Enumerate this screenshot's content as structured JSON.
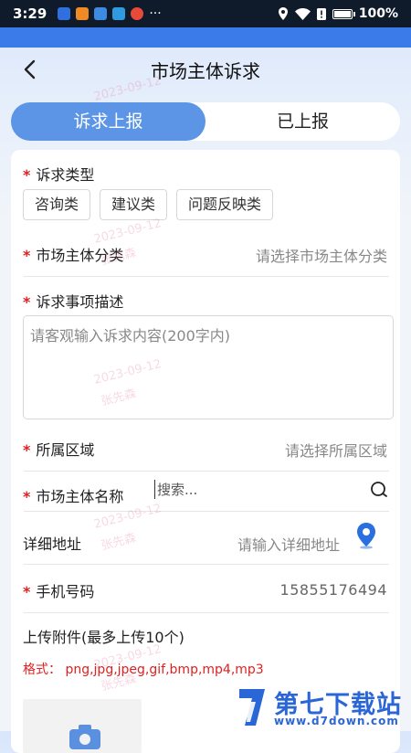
{
  "status_bar": {
    "time": "3:29",
    "more": "···",
    "battery_text": "100%",
    "battery_level": 1.0
  },
  "header": {
    "back_icon": "chevron-left-icon",
    "title": "市场主体诉求"
  },
  "tabs": [
    {
      "label": "诉求上报",
      "active": true
    },
    {
      "label": "已上报",
      "active": false
    }
  ],
  "form": {
    "required_mark": "*",
    "appeal_type": {
      "label": "诉求类型",
      "options": [
        "咨询类",
        "建议类",
        "问题反映类"
      ]
    },
    "entity_category": {
      "label": "市场主体分类",
      "placeholder": "请选择市场主体分类"
    },
    "description": {
      "label": "诉求事项描述",
      "placeholder": "请客观输入诉求内容(200字内)"
    },
    "region": {
      "label": "所属区域",
      "placeholder": "请选择所属区域"
    },
    "entity_name": {
      "label": "市场主体名称",
      "placeholder": "搜索...",
      "icon": "search-icon"
    },
    "address": {
      "label": "详细地址",
      "placeholder": "请输入详细地址",
      "icon": "location-pin-icon"
    },
    "phone": {
      "label": "手机号码",
      "value": "15855176494"
    },
    "attachments": {
      "label": "上传附件(最多上传10个)",
      "format_text": "格式： png,jpg,jpeg,gif,bmp,mp4,mp3",
      "upload_icon": "camera-icon"
    }
  },
  "watermark": {
    "date": "2023-09-12",
    "name": "张先森"
  },
  "logo": {
    "name": "第七下载站",
    "url": "www.d7down.com"
  },
  "colors": {
    "accent": "#5d95e6",
    "required": "#e02020",
    "status_bar": "#0f1a2b",
    "blue_strip": "#3b7ae9"
  }
}
